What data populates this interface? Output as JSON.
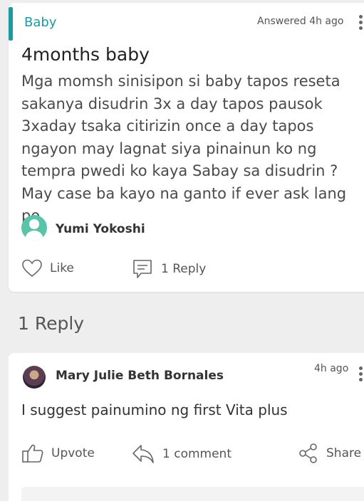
{
  "question": {
    "category": "Baby",
    "answered_label": "Answered 4h ago",
    "title": "4months baby",
    "body": "Mga momsh sinisipon si baby tapos reseta sakanya disudrin 3x a day tapos pausok 3xaday tsaka citirizin once a day tapos ngayon may lagnat siya pinainun ko ng tempra pwedi ko kaya Sabay sa disudrin ? May case ba kayo na ganto if ever ask lang po",
    "author": "Yumi Yokoshi",
    "like_label": "Like",
    "reply_label": "1 Reply"
  },
  "replies_section": {
    "title": "1 Reply"
  },
  "reply": {
    "author": "Mary Julie Beth Bornales",
    "time": "4h ago",
    "text": "I suggest painumino ng first Vita plus",
    "upvote_label": "Upvote",
    "comment_label": "1 comment",
    "share_label": "Share"
  },
  "colors": {
    "accent": "#1b9ba0",
    "avatar_generic": "#5cc3ab"
  },
  "icons": [
    "more-vertical-icon",
    "user-avatar-icon",
    "heart-icon",
    "chat-bubble-icon",
    "thumbs-up-icon",
    "reply-arrow-icon",
    "share-icon"
  ]
}
